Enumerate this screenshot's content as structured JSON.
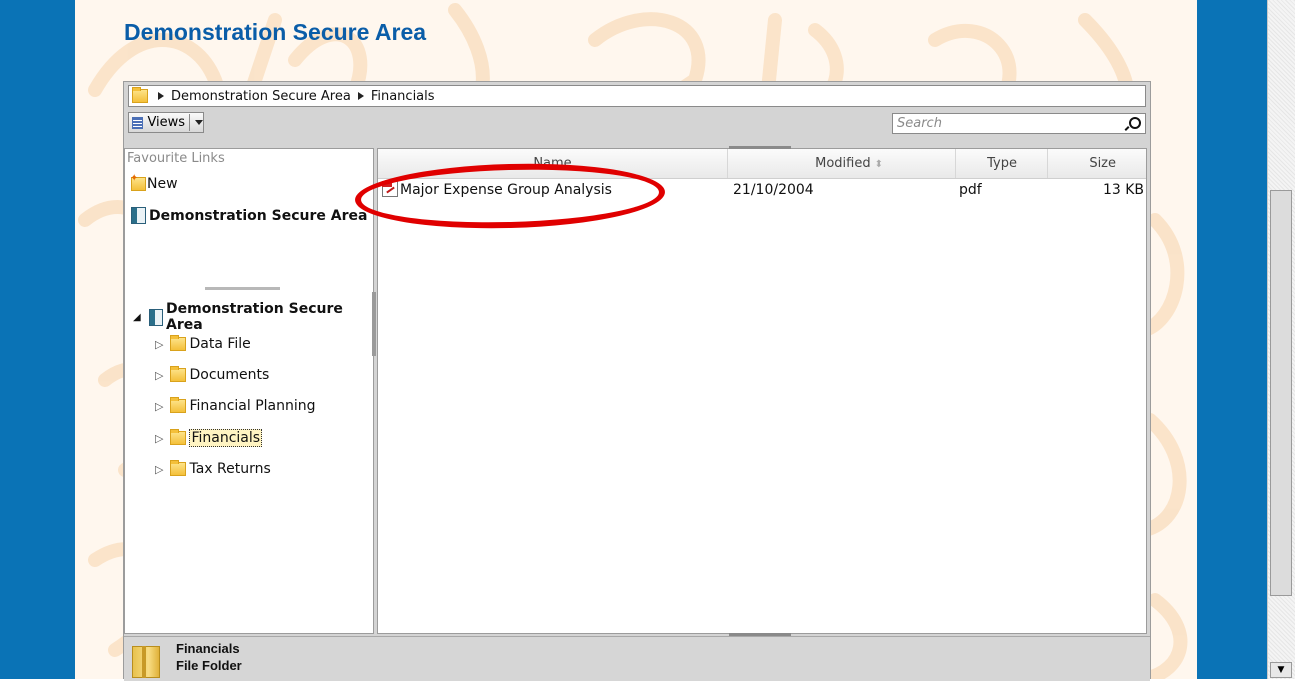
{
  "page": {
    "title": "Demonstration Secure Area"
  },
  "breadcrumb": {
    "items": [
      "Demonstration Secure Area",
      "Financials"
    ]
  },
  "toolbar": {
    "views_label": "Views",
    "search_placeholder": "Search"
  },
  "favourites": {
    "header": "Favourite Links",
    "items": [
      "New",
      "Demonstration Secure Area"
    ]
  },
  "tree": {
    "root": "Demonstration Secure Area",
    "folders": [
      "Data File",
      "Documents",
      "Financial Planning",
      "Financials",
      "Tax Returns"
    ],
    "selected": "Financials"
  },
  "file_list": {
    "columns": [
      "Name",
      "Modified",
      "Type",
      "Size"
    ],
    "rows": [
      {
        "name": "Major Expense Group Analysis",
        "modified": "21/10/2004",
        "type": "pdf",
        "size": "13 KB"
      }
    ]
  },
  "details": {
    "name": "Financials",
    "type": "File Folder"
  },
  "colors": {
    "accent_blue": "#0a73b6",
    "title_blue": "#0a5da8",
    "highlight_red": "#e00000"
  }
}
